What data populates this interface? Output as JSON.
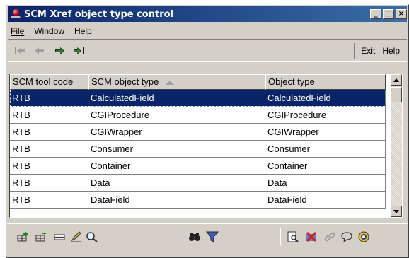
{
  "window": {
    "title": "SCM Xref object type control"
  },
  "titlebar_buttons": {
    "minimize": "_",
    "maximize": "□",
    "close": "×"
  },
  "menu": {
    "file": "File",
    "window": "Window",
    "help": "Help"
  },
  "nav": {
    "exit": "Exit",
    "help": "Help"
  },
  "grid": {
    "columns": [
      "SCM tool code",
      "SCM object type",
      "Object type"
    ],
    "sorted_column": "SCM object type",
    "selected_row": 0,
    "rows": [
      [
        "RTB",
        "CalculatedField",
        "CalculatedField"
      ],
      [
        "RTB",
        "CGIProcedure",
        "CGIProcedure"
      ],
      [
        "RTB",
        "CGIWrapper",
        "CGIWrapper"
      ],
      [
        "RTB",
        "Consumer",
        "Consumer"
      ],
      [
        "RTB",
        "Container",
        "Container"
      ],
      [
        "RTB",
        "Data",
        "Data"
      ],
      [
        "RTB",
        "DataField",
        "DataField"
      ]
    ]
  },
  "colors": {
    "titlebar_start": "#0a246a",
    "titlebar_end": "#3a6ea5",
    "selection": "#0a246a",
    "face": "#d4d0c8"
  }
}
